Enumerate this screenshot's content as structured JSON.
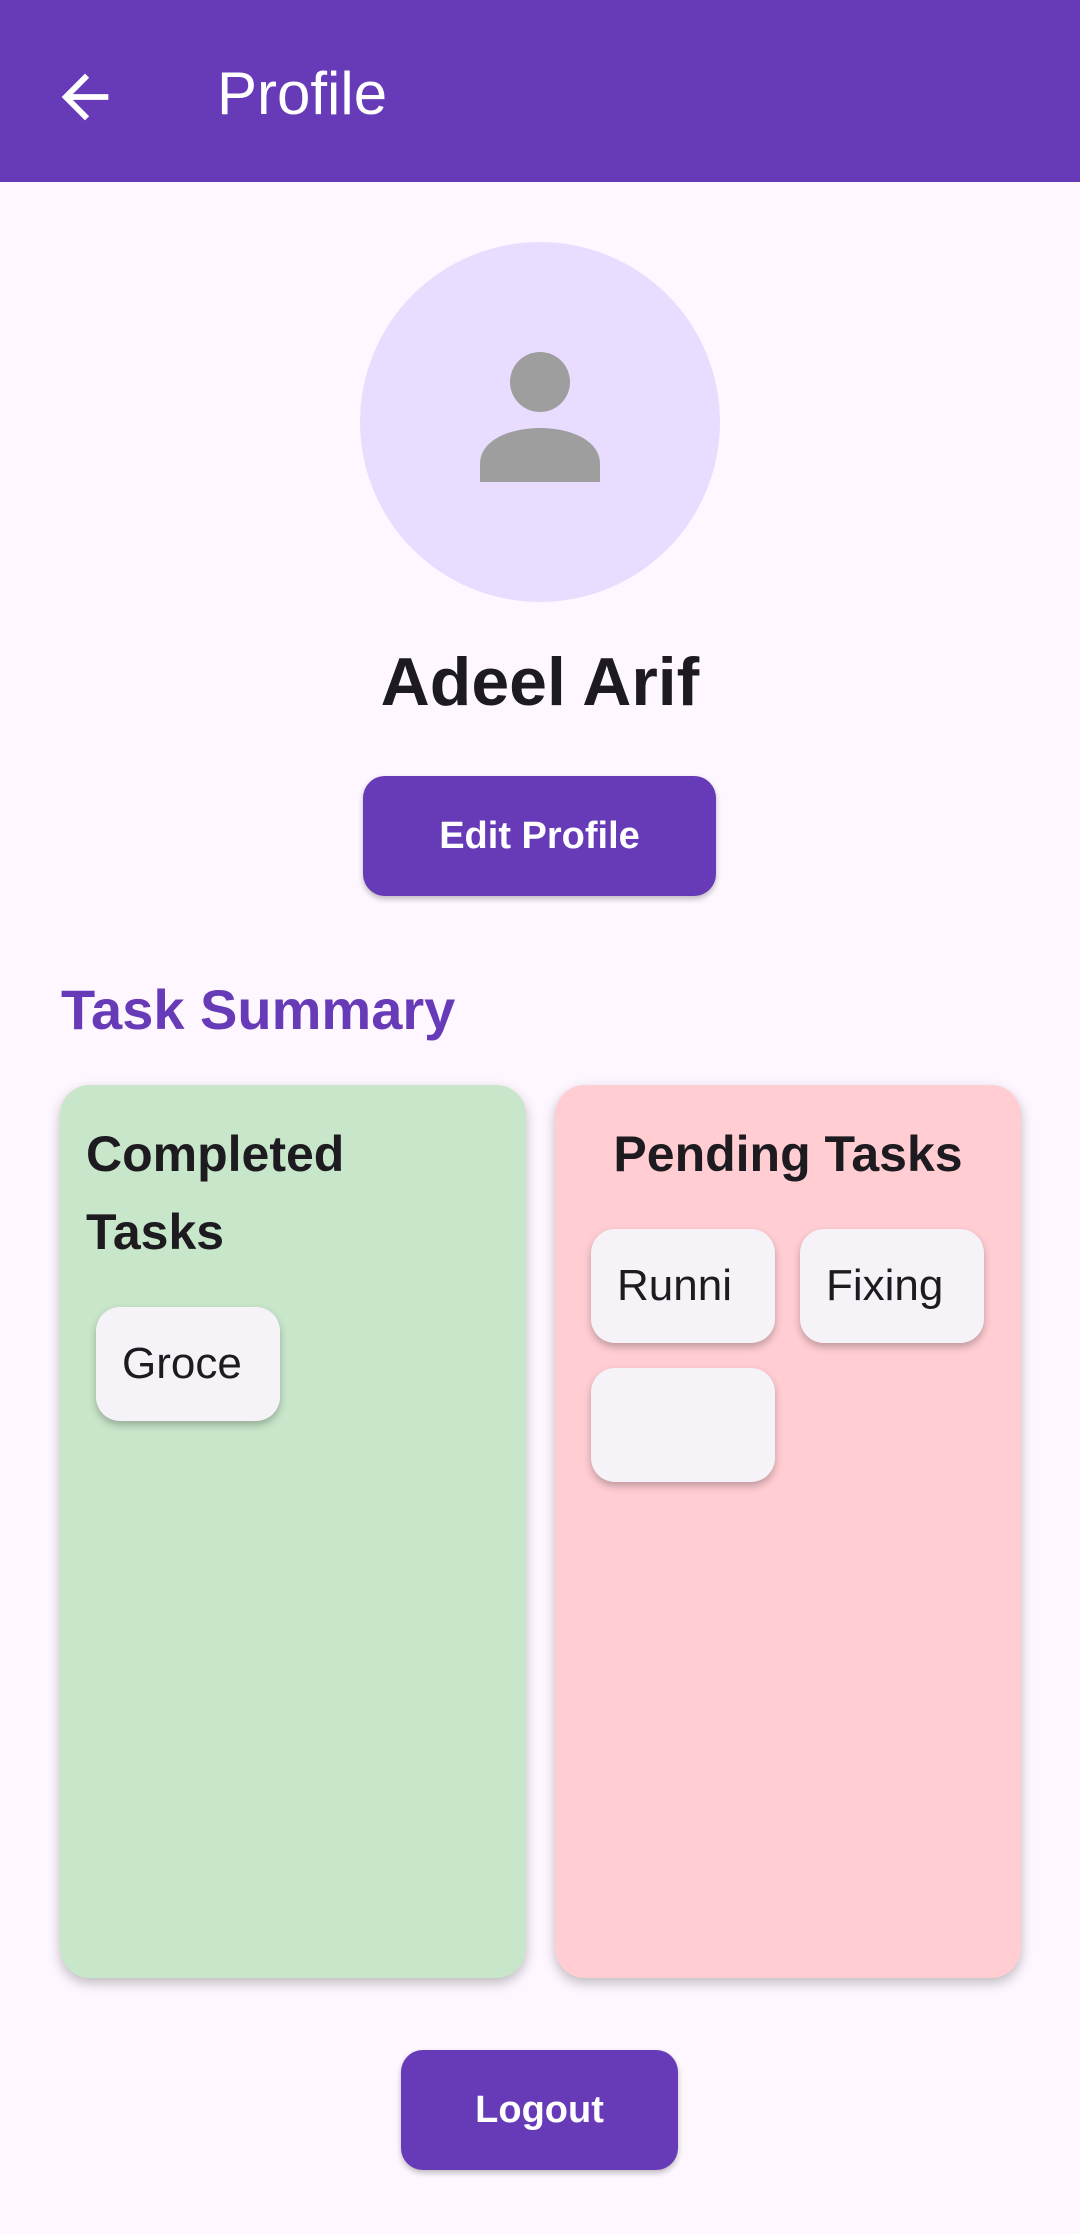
{
  "app_bar": {
    "title": "Profile",
    "back_icon": "arrow-back-icon",
    "color": "#673AB7"
  },
  "profile": {
    "avatar_icon": "person-icon",
    "name": "Adeel Arif",
    "edit_label": "Edit Profile"
  },
  "summary": {
    "title": "Task Summary",
    "completed": {
      "title": "Completed Tasks",
      "color": "#C8E6C9",
      "tasks": [
        "Groce"
      ]
    },
    "pending": {
      "title": "Pending Tasks",
      "color": "#FFCDD2",
      "tasks": [
        "Runni",
        "Fixing",
        ""
      ]
    }
  },
  "logout_label": "Logout"
}
